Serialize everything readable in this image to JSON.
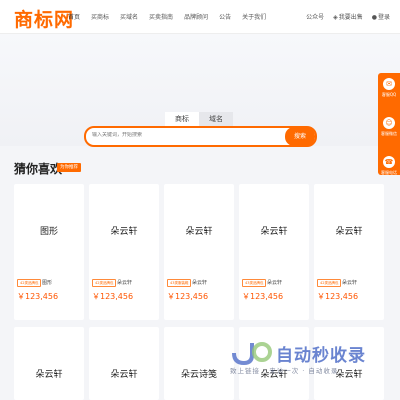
{
  "header": {
    "logo": "商标网",
    "nav": [
      "首页",
      "买商标",
      "买域名",
      "买卖指南",
      "品牌顾问",
      "公告",
      "关于我们"
    ],
    "public_account": "公众号",
    "sell_link": "我要出售",
    "login_link": "登录"
  },
  "search": {
    "tabs": [
      "商标",
      "域名"
    ],
    "placeholder": "输入关键词，开始搜索",
    "button": "搜索"
  },
  "section": {
    "title": "猜你喜欢",
    "tag": "为你推荐"
  },
  "cards_row1": [
    {
      "name": "图形",
      "badge": "42类品牌包",
      "sub": "图形",
      "price": "￥123,456"
    },
    {
      "name": "朵云轩",
      "badge": "42类品牌包",
      "sub": "朵云轩",
      "price": "￥123,456"
    },
    {
      "name": "朵云轩",
      "badge": "43类服装鞋",
      "sub": "朵云轩",
      "price": "￥123,456"
    },
    {
      "name": "朵云轩",
      "badge": "43类品牌包",
      "sub": "朵云轩",
      "price": "￥123,456"
    },
    {
      "name": "朵云轩",
      "badge": "42类品牌包",
      "sub": "朵云轩",
      "price": "￥123,456"
    }
  ],
  "cards_row2": [
    {
      "name": "朵云轩"
    },
    {
      "name": "朵云轩"
    },
    {
      "name": "朵云诗笺"
    },
    {
      "name": "朵云轩"
    },
    {
      "name": "朵云轩"
    }
  ],
  "sidebar": [
    "客服QQ",
    "客服微信",
    "客服电话"
  ],
  "watermark": {
    "brand": "自动秒收录",
    "slogan": "致上链接 · 来访一次 · 自动收录"
  },
  "colors": {
    "accent": "#ff6a00",
    "price": "#ff5500"
  }
}
